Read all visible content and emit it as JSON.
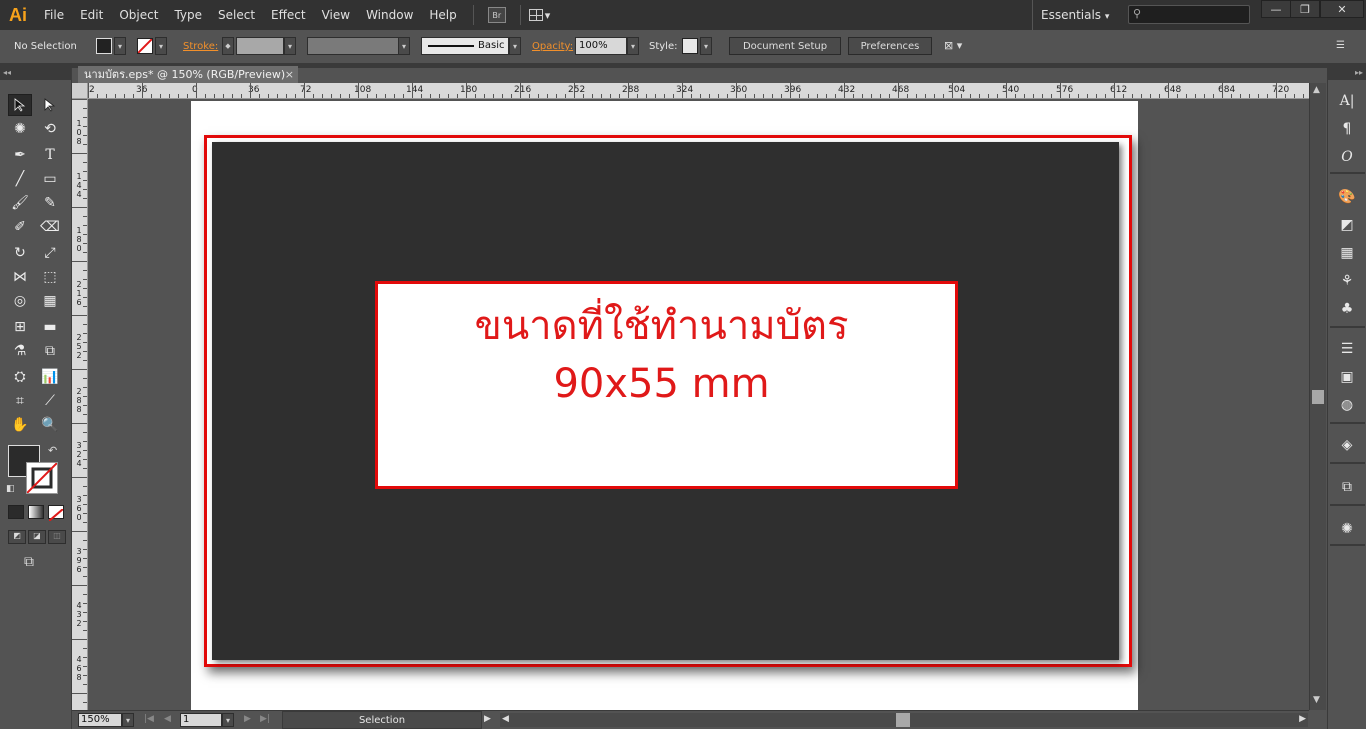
{
  "app": {
    "logo": "Ai",
    "menu": [
      "File",
      "Edit",
      "Object",
      "Type",
      "Select",
      "Effect",
      "View",
      "Window",
      "Help"
    ],
    "bridge_btn": "Br",
    "workspace": "Essentials",
    "search_placeholder": ""
  },
  "control_bar": {
    "selection_label": "No Selection",
    "stroke_label": "Stroke:",
    "brush_label": "Basic",
    "opacity_label": "Opacity:",
    "opacity_value": "100%",
    "style_label": "Style:",
    "document_setup": "Document Setup",
    "preferences": "Preferences"
  },
  "document": {
    "tab_title": "นามบัตร.eps* @ 150% (RGB/Preview)",
    "close_glyph": "×"
  },
  "ruler": {
    "h_labels": [
      "2",
      "36",
      "0",
      "36",
      "72",
      "108",
      "144",
      "180",
      "216",
      "252",
      "288",
      "324",
      "360",
      "396",
      "432",
      "468",
      "504",
      "540",
      "576",
      "612",
      "648",
      "684",
      "720"
    ],
    "v_labels": [
      "1\n0\n8",
      "1\n4\n4",
      "1\n8\n0",
      "2\n1\n6",
      "2\n5\n2",
      "2\n8\n8",
      "3\n2\n4",
      "3\n6\n0",
      "3\n9\n6",
      "4\n3\n2",
      "4\n6\n8"
    ]
  },
  "artwork": {
    "headline": "ขนาดที่ใช้ทำนามบัตร",
    "size_text": "90x55 mm",
    "accent_color": "#e20a0a",
    "card_color": "#2f2f2f"
  },
  "status_bar": {
    "zoom": "150%",
    "page": "1",
    "status_text": "Selection"
  },
  "tools": [
    "selection-tool",
    "direct-selection-tool",
    "magic-wand-tool",
    "lasso-tool",
    "pen-tool",
    "type-tool",
    "line-tool",
    "rectangle-tool",
    "paintbrush-tool",
    "pencil-tool",
    "blob-brush-tool",
    "eraser-tool",
    "rotate-tool",
    "scale-tool",
    "width-tool",
    "free-transform-tool",
    "shape-builder-tool",
    "perspective-grid-tool",
    "mesh-tool",
    "gradient-tool",
    "eyedropper-tool",
    "blend-tool",
    "symbol-sprayer-tool",
    "column-graph-tool",
    "artboard-tool",
    "slice-tool",
    "hand-tool",
    "zoom-tool"
  ],
  "dock_icons": [
    "character-icon",
    "paragraph-icon",
    "opentype-icon",
    "color-guide-icon",
    "color-icon",
    "swatches-icon",
    "brushes-icon",
    "symbols-icon",
    "stroke-icon",
    "gradient-icon",
    "transparency-icon",
    "layers-icon",
    "artboards-icon",
    "appearance-icon"
  ]
}
